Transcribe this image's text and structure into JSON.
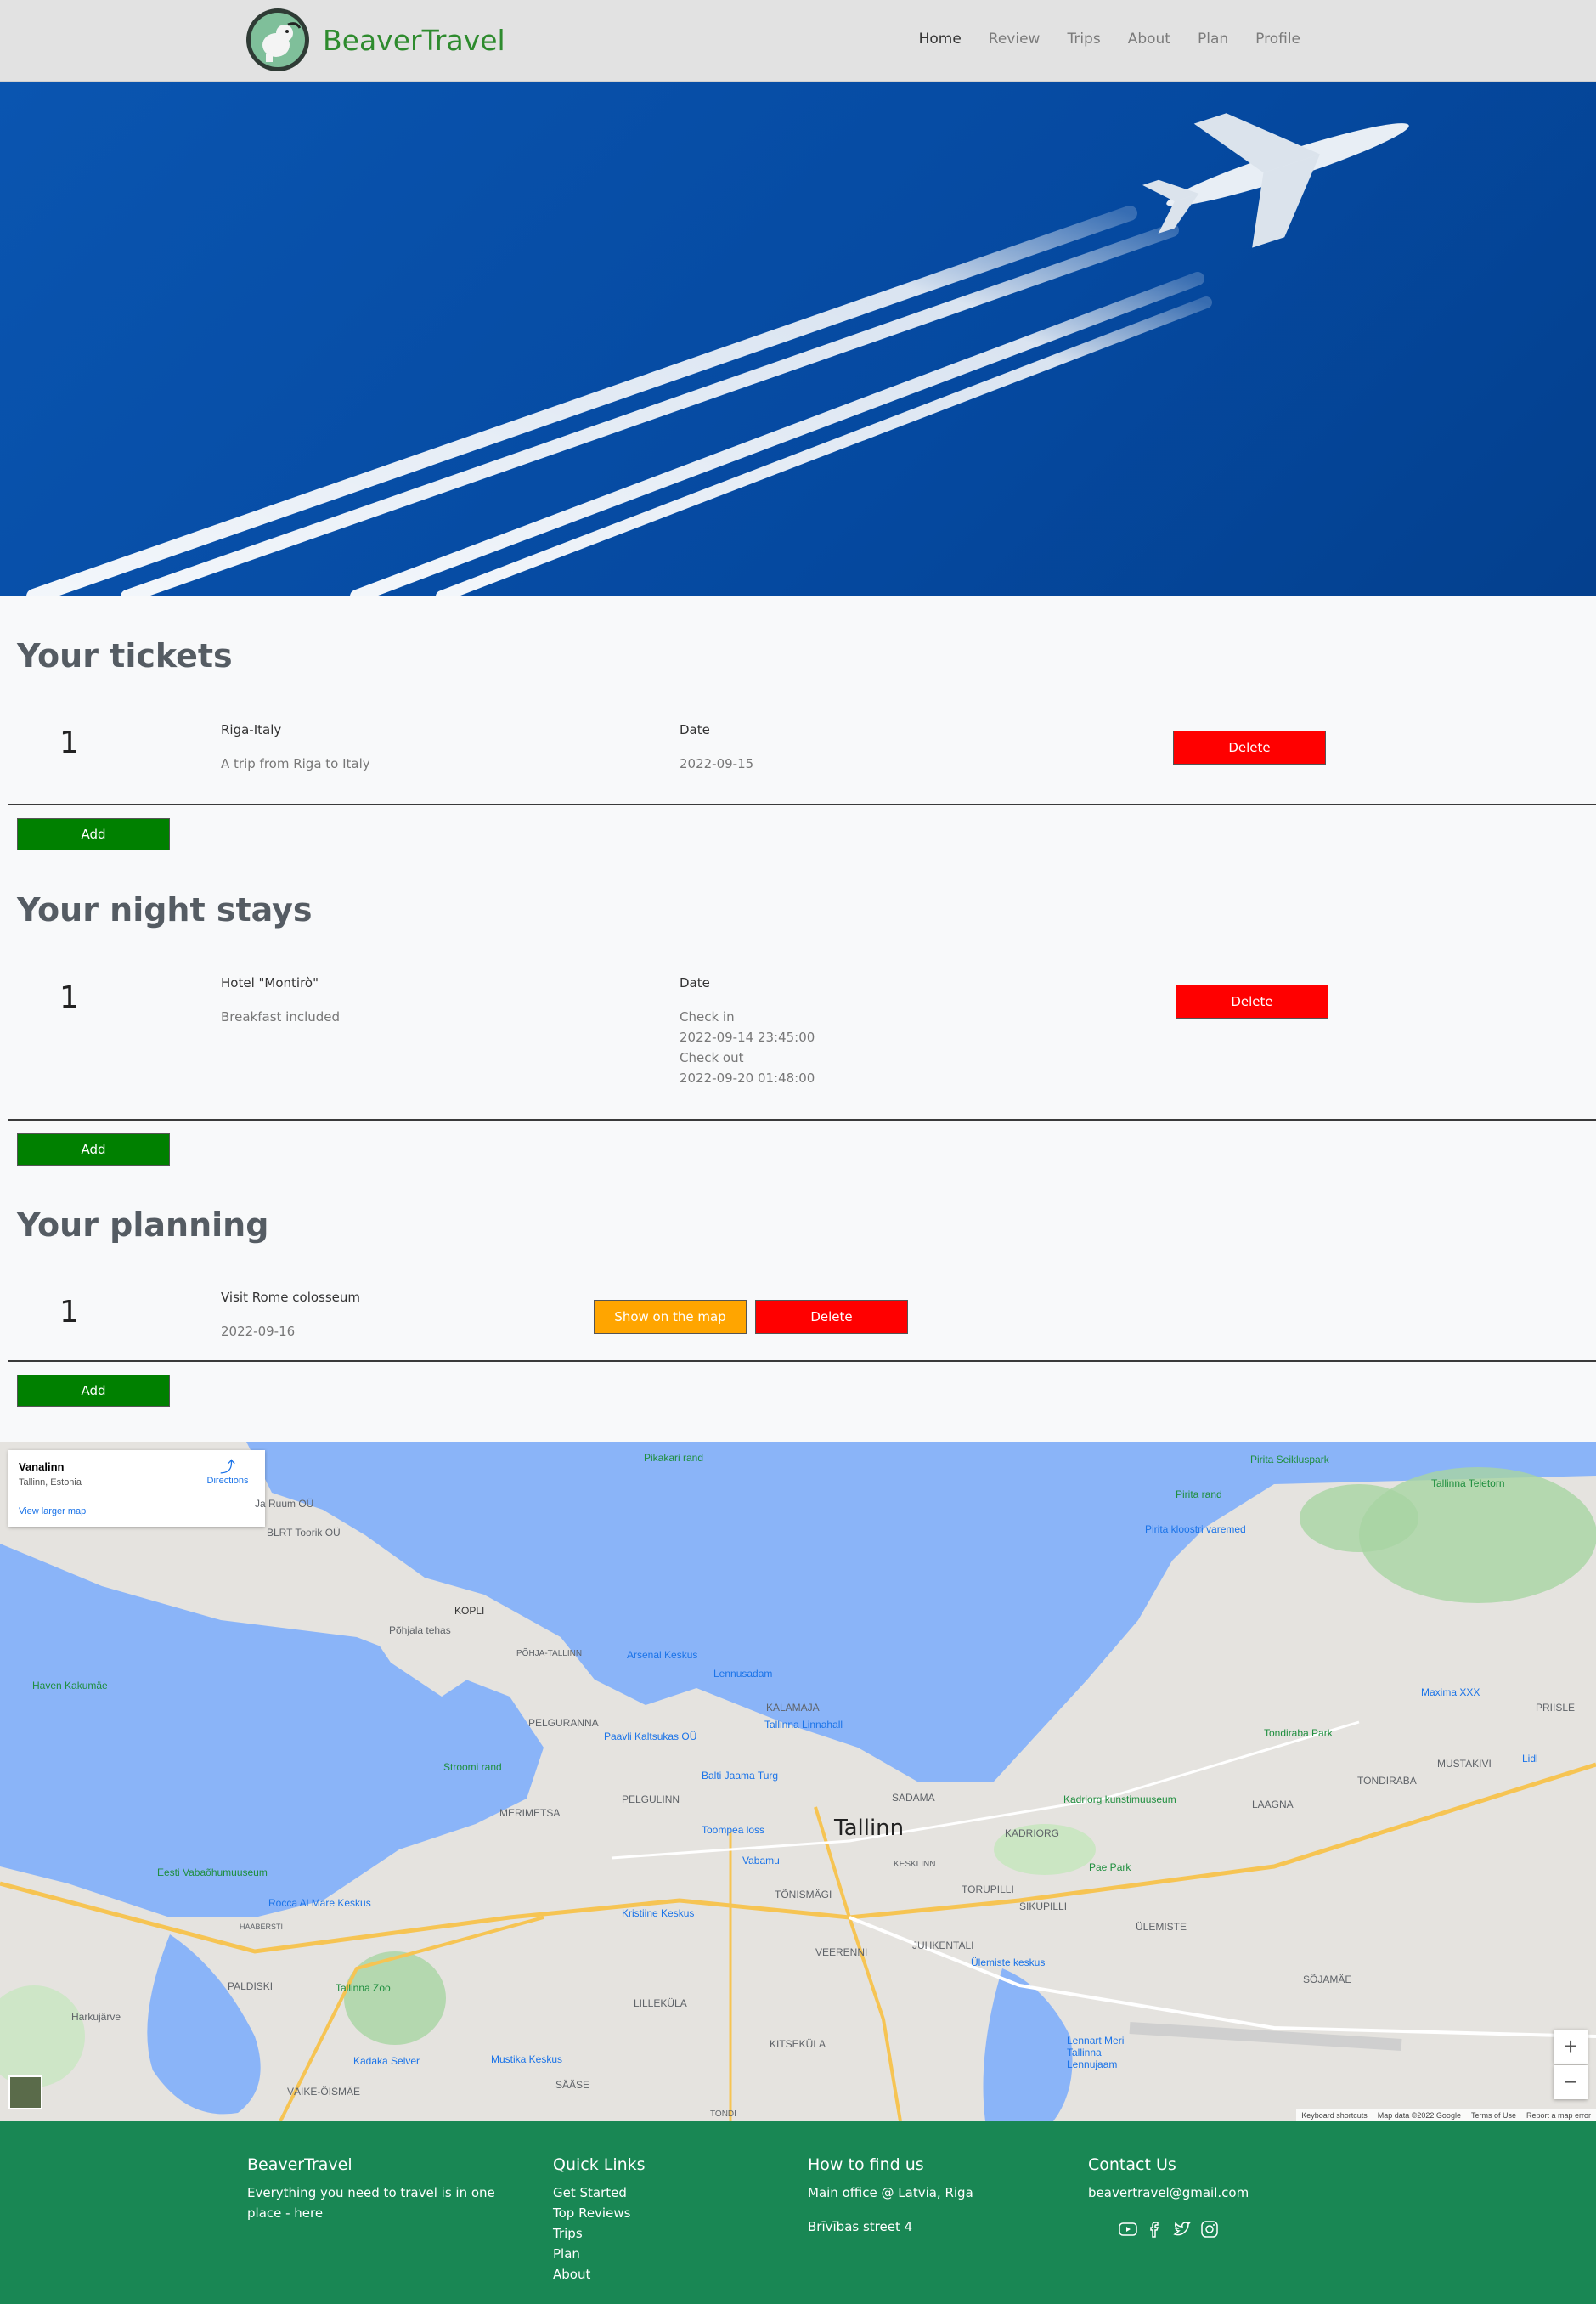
{
  "brand": {
    "name": "BeaverTravel"
  },
  "nav": {
    "items": [
      {
        "label": "Home",
        "active": true
      },
      {
        "label": "Review"
      },
      {
        "label": "Trips"
      },
      {
        "label": "About"
      },
      {
        "label": "Plan"
      },
      {
        "label": "Profile"
      }
    ]
  },
  "tickets": {
    "title": "Your tickets",
    "items": [
      {
        "num": "1",
        "name": "Riga-Italy",
        "desc": "A trip from Riga to Italy",
        "date_label": "Date",
        "date": "2022-09-15",
        "delete_label": "Delete"
      }
    ],
    "add_label": "Add"
  },
  "stays": {
    "title": "Your night stays",
    "items": [
      {
        "num": "1",
        "name": "Hotel \"Montirò\"",
        "desc": "Breakfast included",
        "date_label": "Date",
        "checkin_label": "Check in",
        "checkin": "2022-09-14 23:45:00",
        "checkout_label": "Check out",
        "checkout": "2022-09-20 01:48:00",
        "delete_label": "Delete"
      }
    ],
    "add_label": "Add"
  },
  "planning": {
    "title": "Your planning",
    "items": [
      {
        "num": "1",
        "name": "Visit Rome colosseum",
        "date": "2022-09-16",
        "map_label": "Show on the map",
        "delete_label": "Delete"
      }
    ],
    "add_label": "Add"
  },
  "map": {
    "place_name": "Vanalinn",
    "place_region": "Tallinn, Estonia",
    "larger_map": "View larger map",
    "directions": "Directions",
    "city": "Tallinn",
    "labels": [
      "Pikakari rand",
      "Pirita Seikluspark",
      "Pirita rand",
      "Tallinna Teletorn",
      "Pirita kloostri varemed",
      "KOPLI",
      "Põhjala tehas",
      "PÕHJA-TALLINN",
      "Arsenal Keskus",
      "Lennusadam",
      "KALAMAJA",
      "Tallinna Linnahall",
      "PELGURANNA",
      "Paavli Kaltsukas OÜ",
      "Haven Kakumäe",
      "Stroomi rand",
      "Balti Jaama Turg",
      "PELGULINN",
      "MERIMETSA",
      "SADAMA",
      "KADRIORG",
      "Kadriorg kunstimuuseum",
      "Toompea loss",
      "Vabamu",
      "TÕNISMÄGI",
      "Eesti Vabaõhumuuseum",
      "Rocca Al Mare Keskus",
      "Kristiine Keskus",
      "SIKUPILLI",
      "ÜLEMISTE",
      "Pae Park",
      "Tondiraba Park",
      "Maxima XXX",
      "MUSTAKIVI",
      "LAAGNA",
      "TONDIRABA",
      "PRIISLE",
      "KESKLINN",
      "TORUPILLI",
      "VEERENNI",
      "JUHKENTALI",
      "Ülemiste keskus",
      "SÕJAMÄE",
      "PALDISKI",
      "Tallinna Zoo",
      "Harkujärve",
      "LILLEKÜLA",
      "KITSEKÜLA",
      "Lennart Meri Tallinna Lennujaam",
      "Kadaka Selver",
      "Mustika Keskus",
      "SÄÄSE",
      "VÄIKE-ÕISMÄE",
      "TONDI",
      "HAABERSTI",
      "Lidl",
      "Ja Ruum OÜ",
      "BLRT Toorik OÜ"
    ],
    "attrib": [
      "Keyboard shortcuts",
      "Map data ©2022 Google",
      "Terms of Use",
      "Report a map error"
    ],
    "zoom_in": "+",
    "zoom_out": "−"
  },
  "footer": {
    "about_head": "BeaverTravel",
    "about_text": "Everything you need to travel is in one place - here",
    "links_head": "Quick Links",
    "links": [
      "Get Started",
      "Top Reviews",
      "Trips",
      "Plan",
      "About"
    ],
    "find_head": "How to find us",
    "find_lines": [
      "Main office @ Latvia, Riga",
      "Brīvības street 4"
    ],
    "contact_head": "Contact Us",
    "contact_email": "beavertravel@gmail.com",
    "social_icons": [
      "youtube-icon",
      "facebook-icon",
      "twitter-icon",
      "instagram-icon"
    ]
  }
}
